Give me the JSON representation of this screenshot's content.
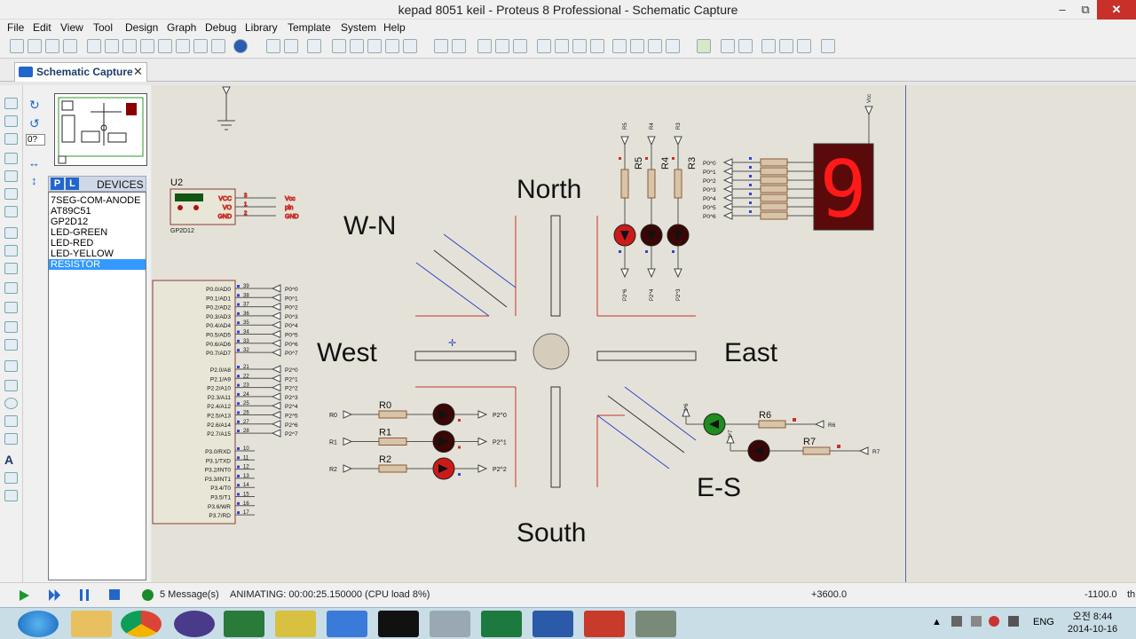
{
  "window": {
    "title": "kepad 8051 keil - Proteus 8 Professional - Schematic Capture"
  },
  "menu": [
    "File",
    "Edit",
    "View",
    "Tool",
    "Design",
    "Graph",
    "Debug",
    "Library",
    "Template",
    "System",
    "Help"
  ],
  "tab": {
    "label": "Schematic Capture"
  },
  "panel": {
    "rotation_value": "0?",
    "pick_label": "P",
    "library_label": "L",
    "devices_label": "DEVICES",
    "devices": [
      "7SEG-COM-ANODE",
      "AT89C51",
      "GP2D12",
      "LED-GREEN",
      "LED-RED",
      "LED-YELLOW",
      "RESISTOR"
    ],
    "selected_device": "RESISTOR"
  },
  "schematic": {
    "labels": {
      "north": "North",
      "south": "South",
      "east": "East",
      "west": "West",
      "wn": "W-N",
      "es": "E-S"
    },
    "u2": {
      "ref": "U2",
      "part": "GP2D12",
      "pins": [
        {
          "num": "3",
          "name": "VCC",
          "net": "Vcc"
        },
        {
          "num": "1",
          "name": "VO",
          "net": "pin"
        },
        {
          "num": "2",
          "name": "GND",
          "net": "GND"
        }
      ]
    },
    "mcu_p0": [
      {
        "pin": "P0.0/AD0",
        "num": "39",
        "net": "P0^0"
      },
      {
        "pin": "P0.1/AD1",
        "num": "38",
        "net": "P0^1"
      },
      {
        "pin": "P0.2/AD2",
        "num": "37",
        "net": "P0^2"
      },
      {
        "pin": "P0.3/AD3",
        "num": "36",
        "net": "P0^3"
      },
      {
        "pin": "P0.4/AD4",
        "num": "35",
        "net": "P0^4"
      },
      {
        "pin": "P0.5/AD5",
        "num": "34",
        "net": "P0^5"
      },
      {
        "pin": "P0.6/AD6",
        "num": "33",
        "net": "P0^6"
      },
      {
        "pin": "P0.7/AD7",
        "num": "32",
        "net": "P0^7"
      }
    ],
    "mcu_p2": [
      {
        "pin": "P2.0/A8",
        "num": "21",
        "net": "P2^0"
      },
      {
        "pin": "P2.1/A9",
        "num": "22",
        "net": "P2^1"
      },
      {
        "pin": "P2.2/A10",
        "num": "23",
        "net": "P2^2"
      },
      {
        "pin": "P2.3/A11",
        "num": "24",
        "net": "P2^3"
      },
      {
        "pin": "P2.4/A12",
        "num": "25",
        "net": "P2^4"
      },
      {
        "pin": "P2.5/A13",
        "num": "26",
        "net": "P2^5"
      },
      {
        "pin": "P2.6/A14",
        "num": "27",
        "net": "P2^6"
      },
      {
        "pin": "P2.7/A15",
        "num": "28",
        "net": "P2^7"
      }
    ],
    "mcu_p3": [
      {
        "pin": "P3.0/RXD",
        "num": "10"
      },
      {
        "pin": "P3.1/TXD",
        "num": "11"
      },
      {
        "pin": "P3.2/INT0",
        "num": "12"
      },
      {
        "pin": "P3.3/INT1",
        "num": "13"
      },
      {
        "pin": "P3.4/T0",
        "num": "14"
      },
      {
        "pin": "P3.5/T1",
        "num": "15"
      },
      {
        "pin": "P3.6/WR",
        "num": "16"
      },
      {
        "pin": "P3.7/RD",
        "num": "17"
      }
    ],
    "west_leds": [
      {
        "in": "R0",
        "res": "R0",
        "out": "P2^0"
      },
      {
        "in": "R1",
        "res": "R1",
        "out": "P2^1"
      },
      {
        "in": "R2",
        "res": "R2",
        "out": "P2^2"
      }
    ],
    "north_leds": [
      {
        "top": "R5",
        "res": "R5",
        "bottom": "P2^6"
      },
      {
        "top": "R4",
        "res": "R4",
        "bottom": "P2^4"
      },
      {
        "top": "R3",
        "res": "R3",
        "bottom": "P2^3"
      }
    ],
    "seg_nets": [
      "P0^0",
      "P0^1",
      "P0^2",
      "P0^3",
      "P0^4",
      "P0^5",
      "P0^6"
    ],
    "seg_power": "Vcc",
    "seg_digit": "9",
    "es_leds": [
      {
        "net": "P2^6",
        "res": "R6",
        "end": "R6"
      },
      {
        "net": "P2^7",
        "res": "R7",
        "end": "R7"
      }
    ]
  },
  "status": {
    "messages": "5 Message(s)",
    "animation": "ANIMATING: 00:00:25.150000 (CPU load 8%)",
    "coord_x": "+3600.0",
    "coord_y": "-1100.0",
    "unit": "th"
  },
  "tray": {
    "lang": "ENG",
    "time": "오전 8:44",
    "date": "2014-10-16"
  },
  "colors": {
    "wire": "#c8312b",
    "blue": "#3344cc",
    "led_off": "#3a0606",
    "led_red": "#cc1a1a",
    "led_green": "#1f8c1f",
    "seg_bg": "#5a0a0a",
    "seg_on": "#ff1a1a"
  }
}
